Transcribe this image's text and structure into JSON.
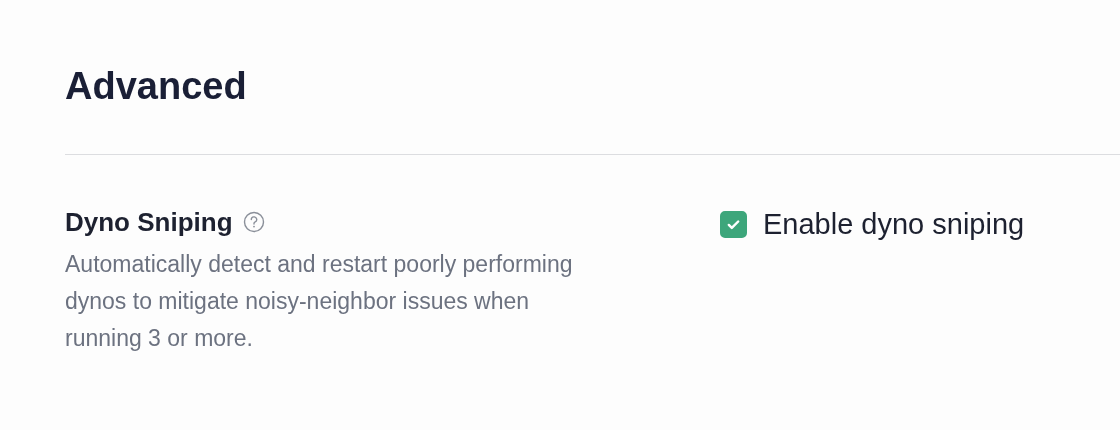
{
  "section": {
    "title": "Advanced"
  },
  "settings": [
    {
      "kind": "checkbox",
      "title": "Dyno Sniping",
      "help": true,
      "description": "Automatically detect and restart poorly performing dynos to mitigate noisy-neighbor issues when running 3 or more.",
      "label": "Enable dyno sniping",
      "checked": true
    }
  ]
}
